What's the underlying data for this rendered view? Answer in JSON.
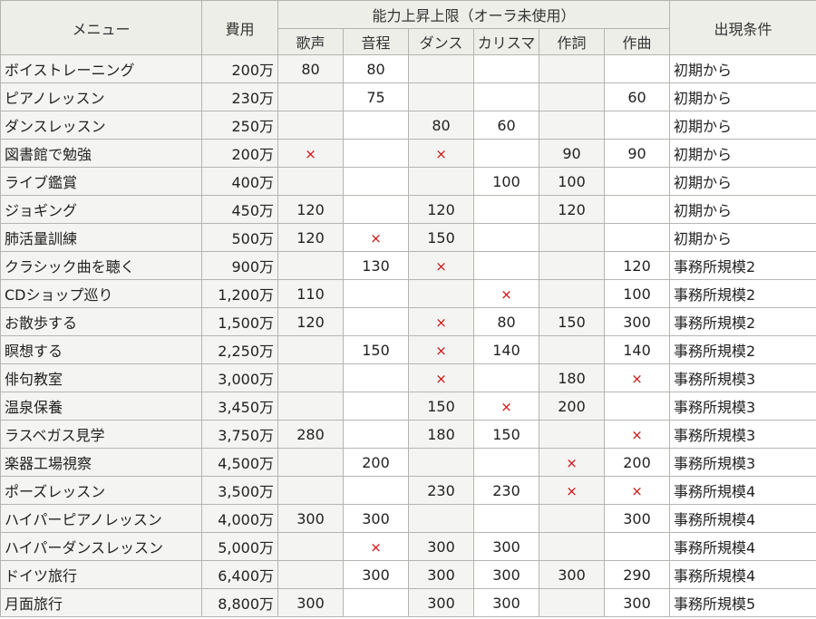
{
  "header": {
    "menu": "メニュー",
    "cost": "費用",
    "ability": "能力上昇上限（オーラ未使用）",
    "condition": "出現条件",
    "stats": [
      "歌声",
      "音程",
      "ダンス",
      "カリスマ",
      "作詞",
      "作曲"
    ]
  },
  "symbols": {
    "cross": "×"
  },
  "rows": [
    {
      "menu": "ボイストレーニング",
      "cost": "200万",
      "v": [
        "80",
        "80",
        "",
        "",
        "",
        ""
      ],
      "cond": "初期から"
    },
    {
      "menu": "ピアノレッスン",
      "cost": "230万",
      "v": [
        "",
        "75",
        "",
        "",
        "",
        "60"
      ],
      "cond": "初期から"
    },
    {
      "menu": "ダンスレッスン",
      "cost": "250万",
      "v": [
        "",
        "",
        "80",
        "60",
        "",
        ""
      ],
      "cond": "初期から"
    },
    {
      "menu": "図書館で勉強",
      "cost": "200万",
      "v": [
        "×",
        "",
        "×",
        "",
        "90",
        "90"
      ],
      "cond": "初期から"
    },
    {
      "menu": "ライブ鑑賞",
      "cost": "400万",
      "v": [
        "",
        "",
        "",
        "100",
        "100",
        ""
      ],
      "cond": "初期から"
    },
    {
      "menu": "ジョギング",
      "cost": "450万",
      "v": [
        "120",
        "",
        "120",
        "",
        "120",
        ""
      ],
      "cond": "初期から"
    },
    {
      "menu": "肺活量訓練",
      "cost": "500万",
      "v": [
        "120",
        "×",
        "150",
        "",
        "",
        ""
      ],
      "cond": "初期から"
    },
    {
      "menu": "クラシック曲を聴く",
      "cost": "900万",
      "v": [
        "",
        "130",
        "×",
        "",
        "",
        "120"
      ],
      "cond": "事務所規模2"
    },
    {
      "menu": "CDショップ巡り",
      "cost": "1,200万",
      "v": [
        "110",
        "",
        "",
        "×",
        "",
        "100"
      ],
      "cond": "事務所規模2"
    },
    {
      "menu": "お散歩する",
      "cost": "1,500万",
      "v": [
        "120",
        "",
        "×",
        "80",
        "150",
        "300"
      ],
      "cond": "事務所規模2"
    },
    {
      "menu": "瞑想する",
      "cost": "2,250万",
      "v": [
        "",
        "150",
        "×",
        "140",
        "",
        "140"
      ],
      "cond": "事務所規模2"
    },
    {
      "menu": "俳句教室",
      "cost": "3,000万",
      "v": [
        "",
        "",
        "×",
        "",
        "180",
        "×"
      ],
      "cond": "事務所規模3"
    },
    {
      "menu": "温泉保養",
      "cost": "3,450万",
      "v": [
        "",
        "",
        "150",
        "×",
        "200",
        ""
      ],
      "cond": "事務所規模3"
    },
    {
      "menu": "ラスベガス見学",
      "cost": "3,750万",
      "v": [
        "280",
        "",
        "180",
        "150",
        "",
        "×"
      ],
      "cond": "事務所規模3"
    },
    {
      "menu": "楽器工場視察",
      "cost": "4,500万",
      "v": [
        "",
        "200",
        "",
        "",
        "×",
        "200"
      ],
      "cond": "事務所規模3"
    },
    {
      "menu": "ポーズレッスン",
      "cost": "3,500万",
      "v": [
        "",
        "",
        "230",
        "230",
        "×",
        "×"
      ],
      "cond": "事務所規模4"
    },
    {
      "menu": "ハイパーピアノレッスン",
      "cost": "4,000万",
      "v": [
        "300",
        "300",
        "",
        "",
        "",
        "300"
      ],
      "cond": "事務所規模4"
    },
    {
      "menu": "ハイパーダンスレッスン",
      "cost": "5,000万",
      "v": [
        "",
        "×",
        "300",
        "300",
        "",
        ""
      ],
      "cond": "事務所規模4"
    },
    {
      "menu": "ドイツ旅行",
      "cost": "6,400万",
      "v": [
        "",
        "300",
        "300",
        "300",
        "300",
        "290"
      ],
      "cond": "事務所規模4"
    },
    {
      "menu": "月面旅行",
      "cost": "8,800万",
      "v": [
        "300",
        "",
        "300",
        "300",
        "",
        "300"
      ],
      "cond": "事務所規模5"
    }
  ]
}
